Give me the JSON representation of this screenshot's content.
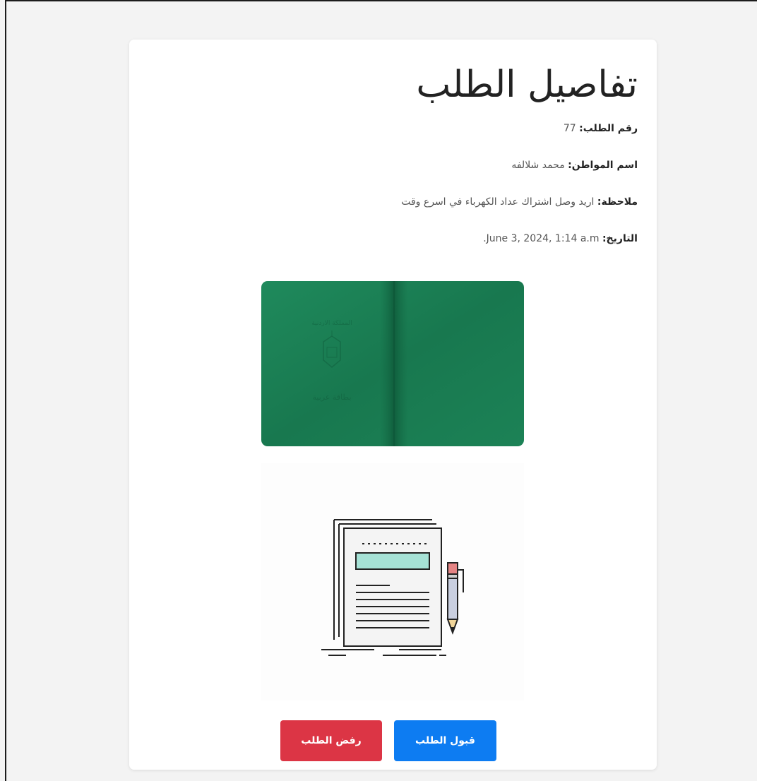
{
  "page": {
    "title": "تفاصيل الطلب"
  },
  "details": {
    "order_number": {
      "label": "رقم الطلب:",
      "value": " 77"
    },
    "citizen_name": {
      "label": "اسم المواطن:",
      "value": " محمد شلالفه"
    },
    "note": {
      "label": "ملاحظة:",
      "value": " اريد وصل اشتراك عداد الكهرباء في اسرع وقت"
    },
    "date": {
      "label": "التاريخ:",
      "value": " June 3, 2024, 1:14 a.m."
    }
  },
  "images": {
    "passport": {
      "name": "passport-image",
      "color": "#1a8055",
      "emblem_text": "المملكة الاردنية",
      "bottom_text": "بطاقة عربية"
    },
    "document": {
      "name": "document-illustration"
    }
  },
  "actions": {
    "accept_label": "قبول الطلب",
    "reject_label": "رفض الطلب"
  },
  "colors": {
    "accept": "#0d7cf2",
    "reject": "#dc3545"
  }
}
